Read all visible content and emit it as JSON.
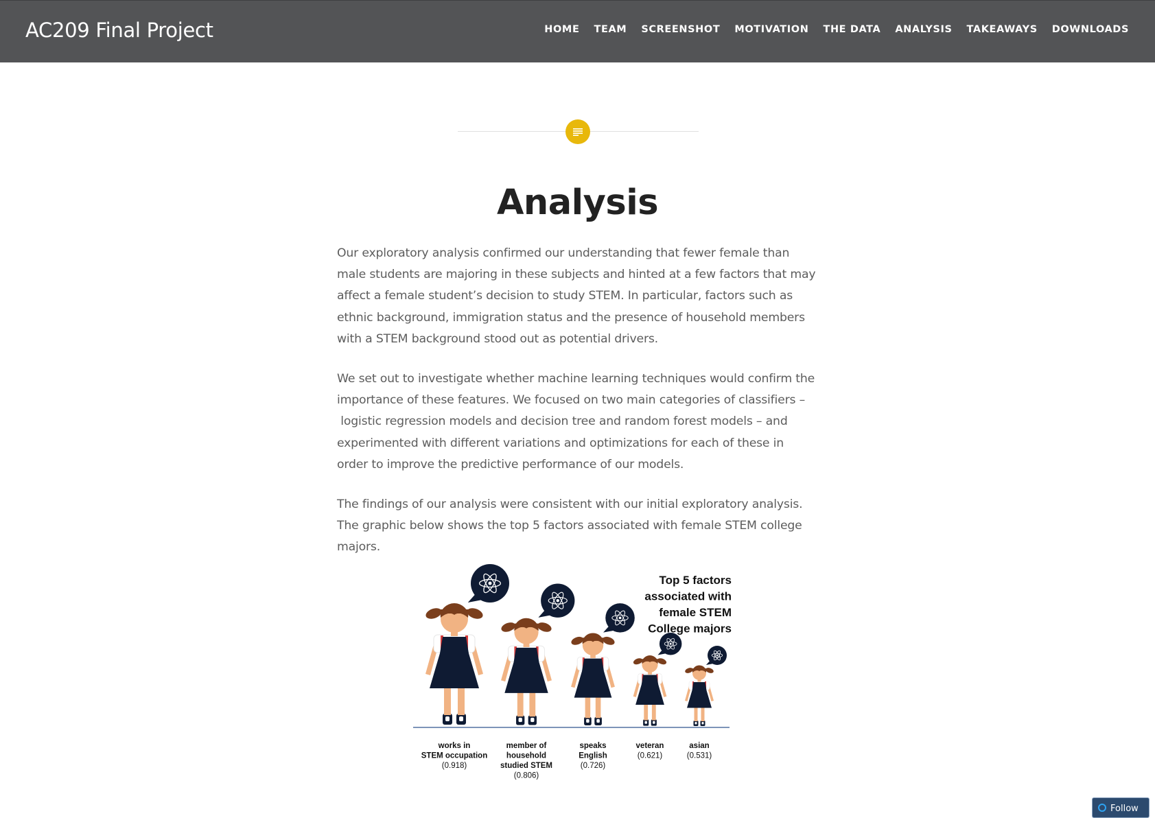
{
  "header": {
    "site_title": "AC209 Final Project",
    "nav": [
      "HOME",
      "TEAM",
      "SCREENSHOT",
      "MOTIVATION",
      "THE DATA",
      "ANALYSIS",
      "TAKEAWAYS",
      "DOWNLOADS"
    ],
    "bg_color": "#535456"
  },
  "post": {
    "format_icon": "text-lines-icon",
    "format_color": "#e8b80b",
    "title": "Analysis",
    "paragraphs": [
      "Our exploratory analysis confirmed our understanding that fewer female than male students are majoring in these subjects and hinted at a few factors that may affect a female student’s decision to study STEM. In particular, factors such as ethnic background, immigration status and the presence of household members with a STEM background stood out as potential drivers.",
      "We set out to investigate whether machine learning techniques would confirm the importance of these features. We focused on two main categories of classifiers –  logistic regression models and decision tree and random forest models – and experimented with different variations and optimizations for each of these in order to improve the predictive performance of our models.",
      "The findings of our analysis were consistent with our initial exploratory analysis. The graphic below shows the top 5 factors associated with female STEM college majors."
    ]
  },
  "infographic": {
    "title_lines": [
      "Top 5 factors",
      "associated with",
      "female STEM",
      "College majors"
    ],
    "factors": [
      {
        "label_lines": [
          "works in",
          "STEM occupation"
        ],
        "value": "(0.918)"
      },
      {
        "label_lines": [
          "member of",
          "household",
          "studied STEM"
        ],
        "value": "(0.806)"
      },
      {
        "label_lines": [
          "speaks",
          "English"
        ],
        "value": "(0.726)"
      },
      {
        "label_lines": [
          "veteran"
        ],
        "value": "(0.621)"
      },
      {
        "label_lines": [
          "asian"
        ],
        "value": "(0.531)"
      }
    ]
  },
  "follow_button": {
    "label": "Follow"
  }
}
